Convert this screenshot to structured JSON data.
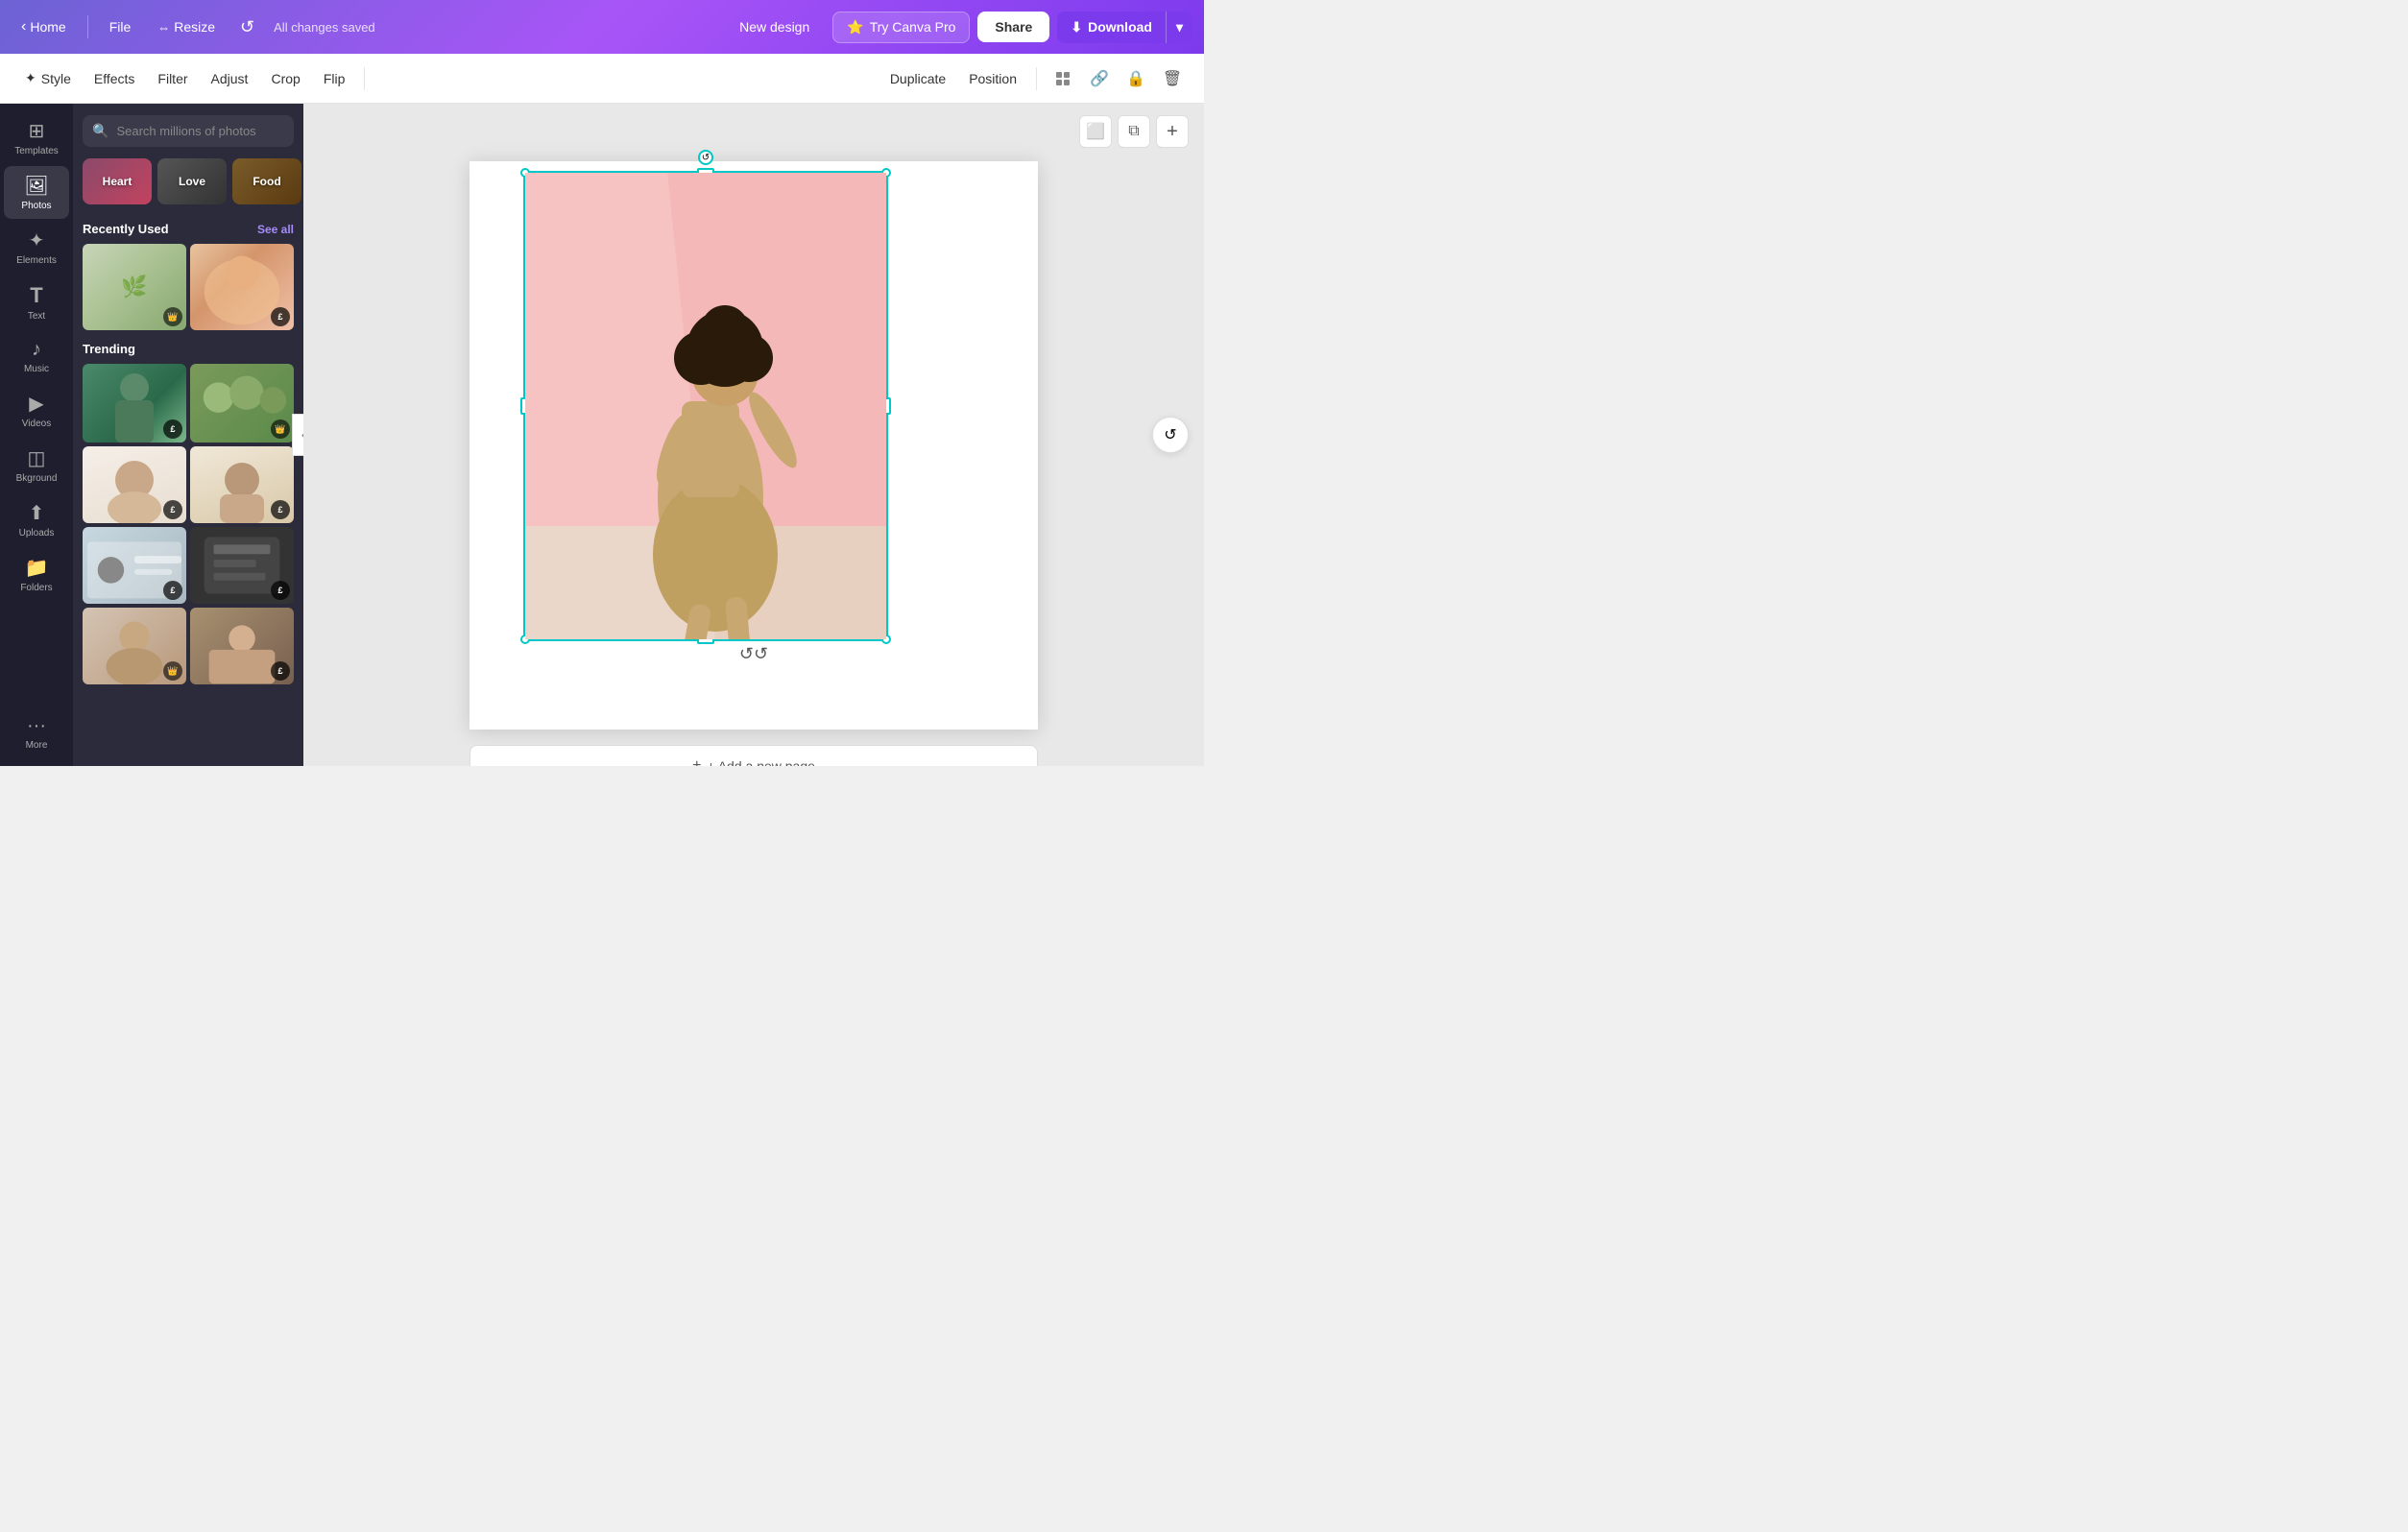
{
  "nav": {
    "home_label": "Home",
    "file_label": "File",
    "resize_label": "Resize",
    "saved_status": "All changes saved",
    "new_design_label": "New design",
    "try_pro_label": "Try Canva Pro",
    "share_label": "Share",
    "download_label": "Download"
  },
  "toolbar": {
    "style_label": "Style",
    "effects_label": "Effects",
    "filter_label": "Filter",
    "adjust_label": "Adjust",
    "crop_label": "Crop",
    "flip_label": "Flip",
    "duplicate_label": "Duplicate",
    "position_label": "Position"
  },
  "sidebar": {
    "items": [
      {
        "id": "templates",
        "label": "Templates",
        "icon": "⊞"
      },
      {
        "id": "photos",
        "label": "Photos",
        "icon": "🖼"
      },
      {
        "id": "elements",
        "label": "Elements",
        "icon": "✦"
      },
      {
        "id": "text",
        "label": "Text",
        "icon": "T"
      },
      {
        "id": "music",
        "label": "Music",
        "icon": "♪"
      },
      {
        "id": "videos",
        "label": "Videos",
        "icon": "▶"
      },
      {
        "id": "background",
        "label": "Bkground",
        "icon": "◫"
      },
      {
        "id": "uploads",
        "label": "Uploads",
        "icon": "↑"
      },
      {
        "id": "folders",
        "label": "Folders",
        "icon": "📁"
      },
      {
        "id": "more",
        "label": "More",
        "icon": "···"
      }
    ]
  },
  "photos_panel": {
    "search_placeholder": "Search millions of photos",
    "categories": [
      {
        "id": "heart",
        "label": "Heart"
      },
      {
        "id": "love",
        "label": "Love"
      },
      {
        "id": "food",
        "label": "Food"
      }
    ],
    "recently_used_label": "Recently Used",
    "see_all_label": "See all",
    "trending_label": "Trending"
  },
  "canvas": {
    "add_page_label": "+ Add a new page"
  }
}
